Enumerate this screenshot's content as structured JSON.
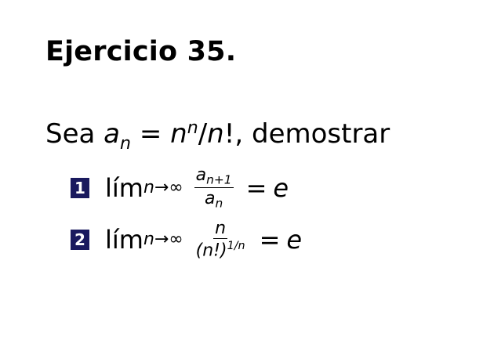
{
  "slide": {
    "title": "Ejercicio 35.",
    "intro": {
      "prefix": "Sea ",
      "a": "a",
      "a_sub": "n",
      "eq": " = ",
      "n1": "n",
      "n1_sup": "n",
      "slash": "/",
      "n2": "n",
      "bang": "!",
      "suffix": ", demostrar"
    },
    "items": [
      {
        "badge": "1",
        "lim": "lím",
        "lim_sub": "n→∞",
        "num_base": "a",
        "num_sub": "n+1",
        "den_base": "a",
        "den_sub": "n",
        "eq": "=",
        "rhs": "e"
      },
      {
        "badge": "2",
        "lim": "lím",
        "lim_sub": "n→∞",
        "num": "n",
        "den_base": "(n!)",
        "den_sup": "1/n",
        "eq": "=",
        "rhs": "e"
      }
    ],
    "colors": {
      "badge_bg": "#1a1a5e",
      "text": "#000000",
      "background": "#ffffff"
    }
  }
}
